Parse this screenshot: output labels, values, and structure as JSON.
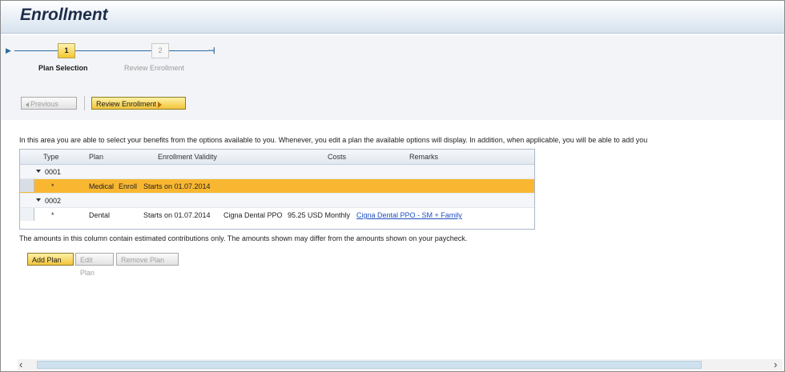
{
  "header": {
    "title": "Enrollment"
  },
  "roadmap": {
    "steps": [
      {
        "number": "1",
        "label": "Plan Selection"
      },
      {
        "number": "2",
        "label": "Review Enrollment"
      }
    ]
  },
  "toolbar": {
    "previous_label": "Previous",
    "review_label": "Review Enrollment"
  },
  "content": {
    "intro": "In this area you are able to select your benefits from the options available to you. Whenever, you edit a plan the available options will display. In addition, when applicable, you will be able to add you",
    "table": {
      "headers": {
        "type": "Type",
        "plan": "Plan",
        "validity": "Enrollment Validity",
        "costs": "Costs",
        "remarks": "Remarks"
      },
      "groups": [
        {
          "code": "0001",
          "rows": [
            {
              "type": "*",
              "plan": "Medical",
              "action": "Enroll",
              "validity": "Starts on 01.07.2014",
              "option": "",
              "costs": "",
              "remarks": ""
            }
          ]
        },
        {
          "code": "0002",
          "rows": [
            {
              "type": "*",
              "plan": "Dental",
              "action": "",
              "validity": "Starts on 01.07.2014",
              "option": "Cigna Dental PPO",
              "costs": "95.25 USD Monthly",
              "remarks": "Cigna Dental PPO - SM + Family"
            }
          ]
        }
      ]
    },
    "note": "The amounts in this column contain estimated contributions only. The amounts shown may differ from the amounts shown on your paycheck.",
    "buttons": {
      "add": "Add Plan",
      "edit": "Edit Plan",
      "remove": "Remove Plan"
    }
  },
  "colors": {
    "accent": "#f9b731",
    "link": "#1f4fbf",
    "title": "#1d2d4a"
  }
}
